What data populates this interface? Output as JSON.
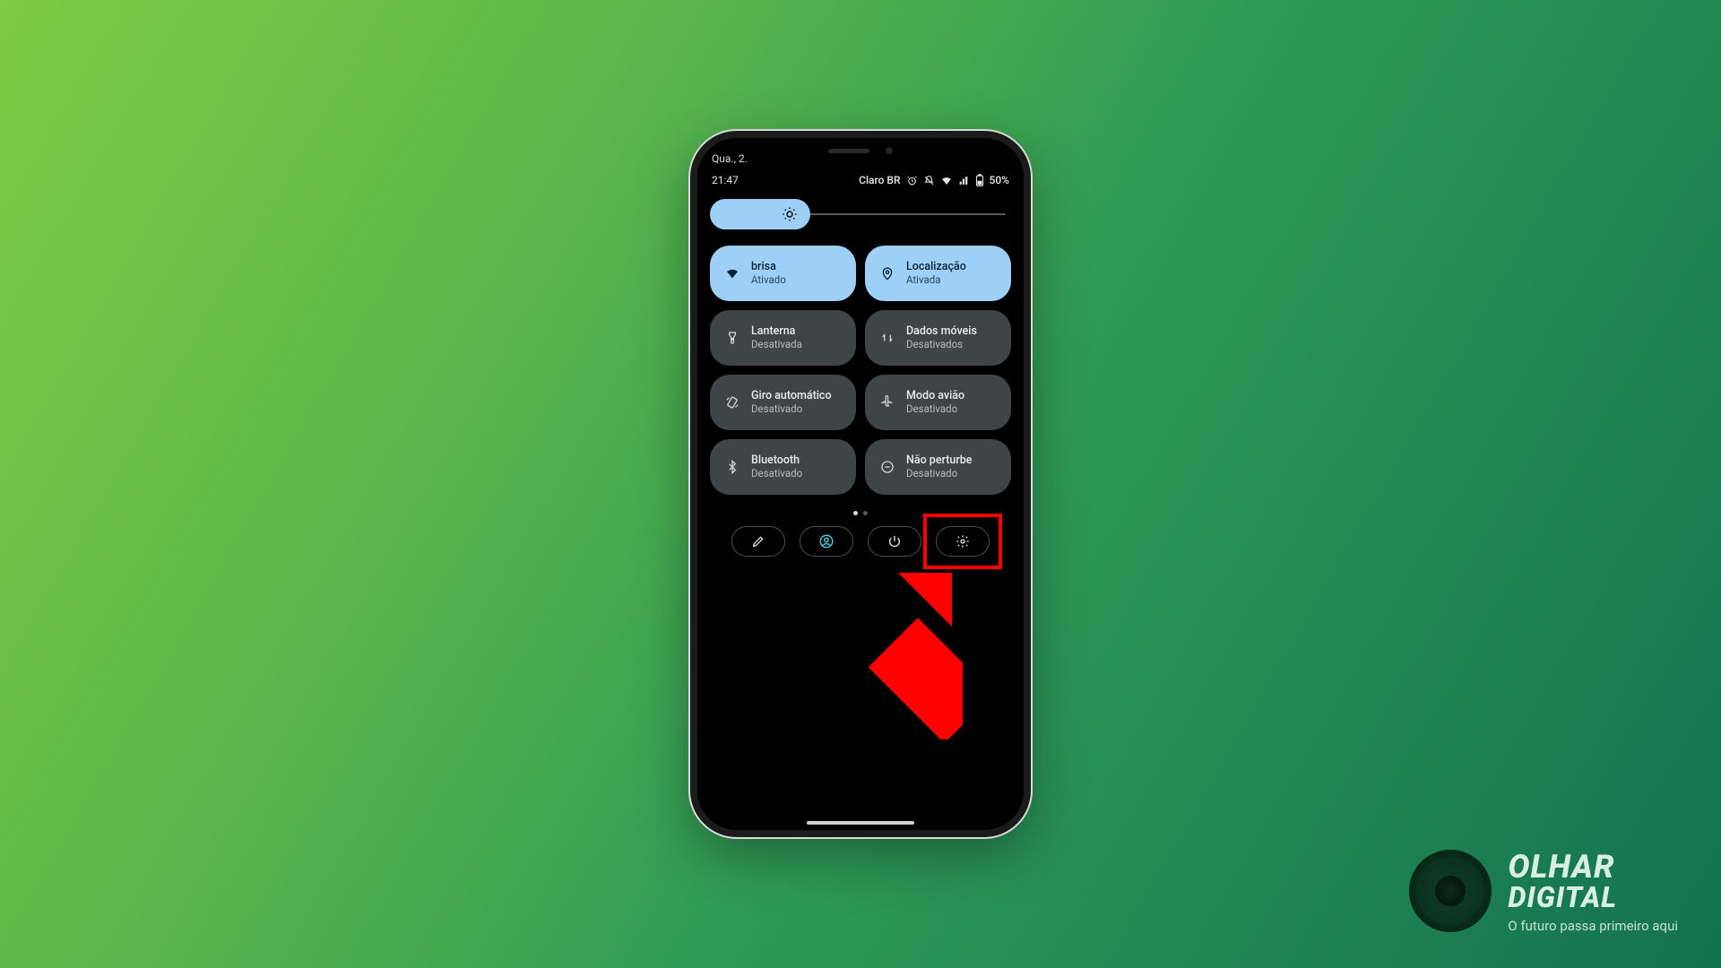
{
  "status": {
    "date": "Qua., 2.",
    "time": "21:47",
    "carrier": "Claro BR",
    "battery_pct": "50%"
  },
  "brightness": {
    "level_pct": 32
  },
  "tiles": [
    {
      "icon": "wifi-icon",
      "title": "brisa",
      "subtitle": "Ativado",
      "active": true
    },
    {
      "icon": "location-icon",
      "title": "Localização",
      "subtitle": "Ativada",
      "active": true
    },
    {
      "icon": "flashlight-icon",
      "title": "Lanterna",
      "subtitle": "Desativada",
      "active": false
    },
    {
      "icon": "mobile-data-icon",
      "title": "Dados móveis",
      "subtitle": "Desativados",
      "active": false
    },
    {
      "icon": "auto-rotate-icon",
      "title": "Giro automático",
      "subtitle": "Desativado",
      "active": false
    },
    {
      "icon": "airplane-icon",
      "title": "Modo avião",
      "subtitle": "Desativado",
      "active": false
    },
    {
      "icon": "bluetooth-icon",
      "title": "Bluetooth",
      "subtitle": "Desativado",
      "active": false
    },
    {
      "icon": "dnd-icon",
      "title": "Não perturbe",
      "subtitle": "Desativado",
      "active": false
    }
  ],
  "page_indicator": {
    "count": 2,
    "active_index": 0
  },
  "actions": [
    {
      "name": "edit-button",
      "icon": "pencil-icon"
    },
    {
      "name": "user-button",
      "icon": "user-circle-icon"
    },
    {
      "name": "power-button",
      "icon": "power-icon"
    },
    {
      "name": "settings-button",
      "icon": "gear-icon"
    }
  ],
  "highlight": {
    "target_action_index": 3
  },
  "brand": {
    "line1": "OLHAR",
    "line2": "DIGITAL",
    "tagline": "O futuro passa primeiro aqui"
  }
}
